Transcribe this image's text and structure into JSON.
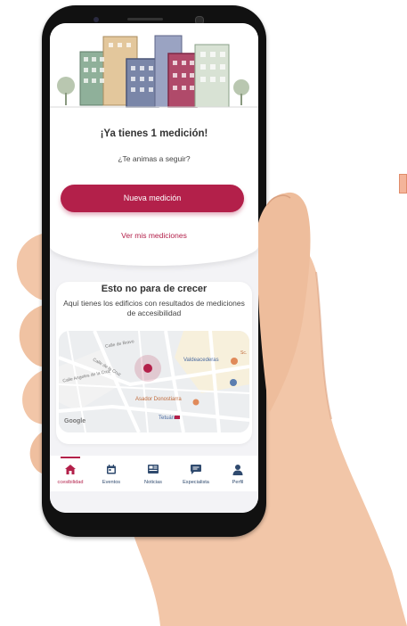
{
  "top": {
    "title": "¡Ya tienes 1 medición!",
    "subtitle": "¿Te animas a seguir?",
    "primary_button": "Nueva medición",
    "link": "Ver mis mediciones"
  },
  "section": {
    "title": "Esto no para de crecer",
    "description": "Aquí tienes los edificios con resultados de mediciones de accesibilidad"
  },
  "map": {
    "labels": {
      "street1": "Calle de Bravo",
      "street2": "Calle de la Cruz",
      "street3": "Calle Angeles de la Cruz",
      "place1": "Valdeacederas",
      "place2": "Asador Donostiarra",
      "place3": "Tetuán",
      "place4": "Sc.",
      "logo": "Google"
    }
  },
  "tabs": [
    {
      "label": "ccesibilidad",
      "icon": "home-icon",
      "active": true
    },
    {
      "label": "Eventos",
      "icon": "calendar-icon",
      "active": false
    },
    {
      "label": "Noticias",
      "icon": "news-icon",
      "active": false
    },
    {
      "label": "Especialista",
      "icon": "chat-icon",
      "active": false
    },
    {
      "label": "Perfil",
      "icon": "user-icon",
      "active": false
    }
  ],
  "colors": {
    "accent": "#b3204a",
    "tab_text": "#2f4a6e",
    "phone_frame": "#111111",
    "skin": "#f2c6a8"
  }
}
